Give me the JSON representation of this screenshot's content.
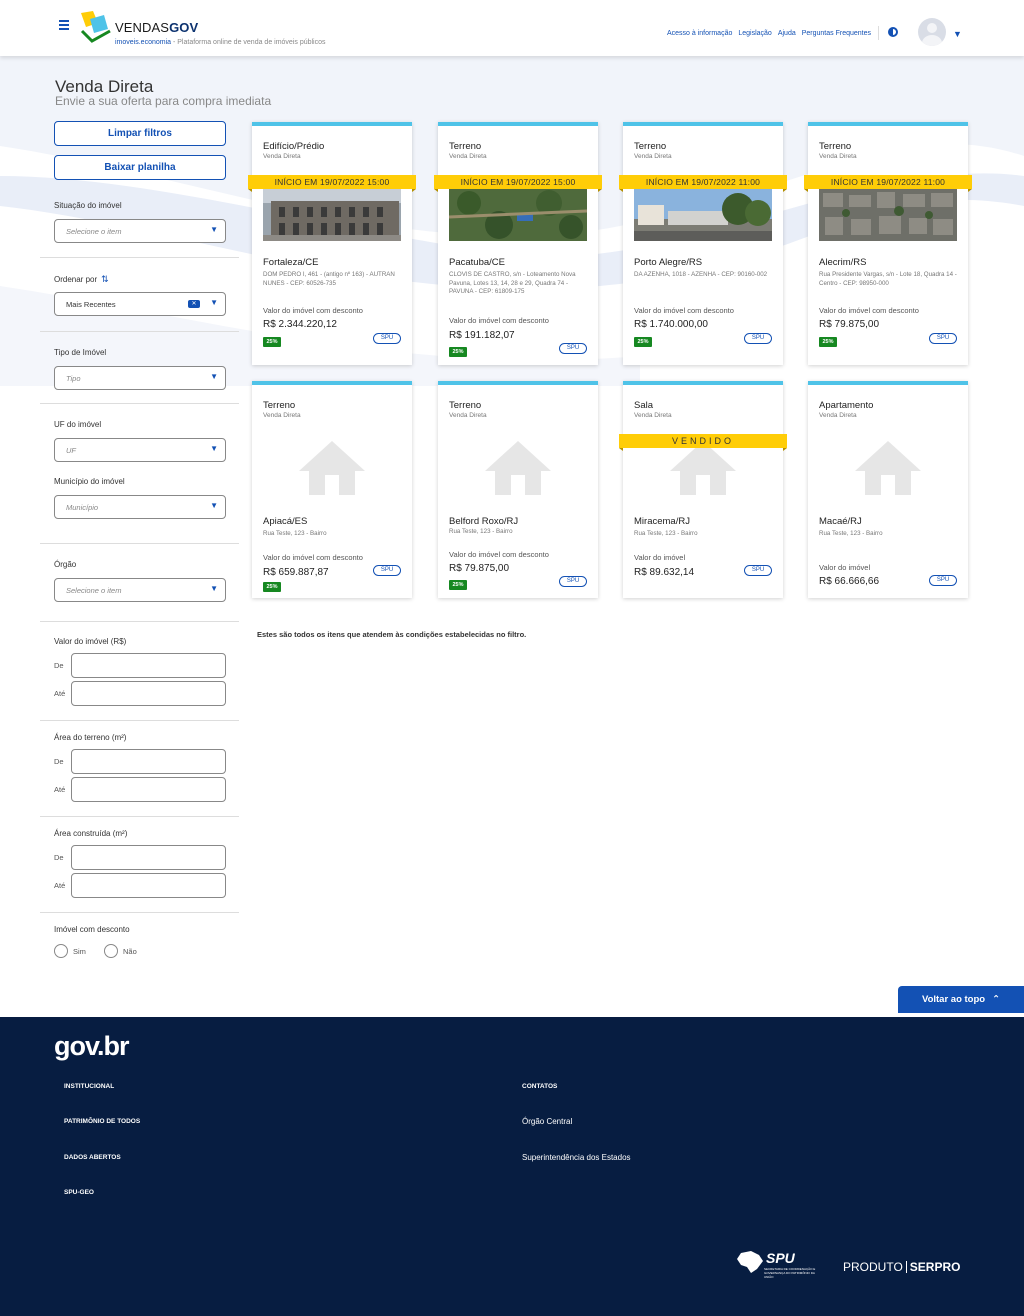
{
  "header": {
    "brand_prefix": "VENDAS",
    "brand_suffix": "GOV",
    "subtitle_domain": "imoveis.economia",
    "subtitle_text": " - Plataforma online de venda de imóveis públicos",
    "links": [
      "Acesso à informação",
      "Legislação",
      "Ajuda",
      "Perguntas Frequentes"
    ],
    "colors": {
      "primary": "#1351b4",
      "accent_yellow": "#ffcd07",
      "footer_bg": "#071d41"
    }
  },
  "page": {
    "title": "Venda Direta",
    "subtitle": "Envie a sua oferta para compra imediata"
  },
  "sidebar": {
    "clear_filters": "Limpar filtros",
    "download_sheet": "Baixar planilha",
    "situation_label": "Situação do imóvel",
    "situation_placeholder": "Selecione o item",
    "order_label": "Ordenar por",
    "order_value": "Mais Recentes",
    "type_label": "Tipo de Imóvel",
    "type_placeholder": "Tipo",
    "uf_label": "UF do imóvel",
    "uf_placeholder": "UF",
    "city_label": "Município do imóvel",
    "city_placeholder": "Município",
    "organ_label": "Órgão",
    "organ_placeholder": "Selecione o item",
    "value_label": "Valor do imóvel (R$)",
    "land_area_label": "Área do terreno (m²)",
    "built_area_label": "Área construída (m²)",
    "from_label": "De",
    "to_label": "Até",
    "discount_label": "Imóvel com desconto",
    "yes_label": "Sim",
    "no_label": "Não"
  },
  "cards": [
    {
      "type": "Edifício/Prédio",
      "mode": "Venda Direta",
      "ribbon": "INÍCIO EM 19/07/2022 15:00",
      "city": "Fortaleza/CE",
      "address": "DOM PEDRO I, 461 - (antigo nº 163) - AUTRAN NUNES - CEP: 60526-735",
      "value_label": "Valor do imóvel com desconto",
      "price": "R$ 2.344.220,12",
      "discount": "25%",
      "tag": "SPU",
      "photo": "building"
    },
    {
      "type": "Terreno",
      "mode": "Venda Direta",
      "ribbon": "INÍCIO EM 19/07/2022 15:00",
      "city": "Pacatuba/CE",
      "address": "CLOVIS DE CASTRO, s/n - Loteamento Nova Pavuna, Lotes 13, 14, 28 e 29, Quadra 74 - PAVUNA - CEP: 61809-175",
      "value_label": "Valor do imóvel com desconto",
      "price": "R$ 191.182,07",
      "discount": "25%",
      "tag": "SPU",
      "photo": "aerial-green"
    },
    {
      "type": "Terreno",
      "mode": "Venda Direta",
      "ribbon": "INÍCIO EM 19/07/2022 11:00",
      "city": "Porto Alegre/RS",
      "address": "DA AZENHA, 1018 - AZENHA - CEP: 90160-002",
      "value_label": "Valor do imóvel com desconto",
      "price": "R$ 1.740.000,00",
      "discount": "25%",
      "tag": "SPU",
      "photo": "street"
    },
    {
      "type": "Terreno",
      "mode": "Venda Direta",
      "ribbon": "INÍCIO EM 19/07/2022 11:00",
      "city": "Alecrim/RS",
      "address": "Rua Presidente Vargas, s/n - Lote 18, Quadra 14 - Centro - CEP: 98950-000",
      "value_label": "Valor do imóvel com desconto",
      "price": "R$ 79.875,00",
      "discount": "25%",
      "tag": "SPU",
      "photo": "aerial-town"
    },
    {
      "type": "Terreno",
      "mode": "Venda Direta",
      "city": "Apiacá/ES",
      "address": "Rua Teste, 123 - Bairro",
      "value_label": "Valor do imóvel com desconto",
      "price": "R$ 659.887,87",
      "discount": "25%",
      "tag": "SPU"
    },
    {
      "type": "Terreno",
      "mode": "Venda Direta",
      "city": "Belford Roxo/RJ",
      "address": "Rua Teste, 123 - Bairro",
      "value_label": "Valor do imóvel com desconto",
      "price": "R$ 79.875,00",
      "discount": "25%",
      "tag": "SPU"
    },
    {
      "type": "Sala",
      "mode": "Venda Direta",
      "ribbon": "VENDIDO",
      "city": "Miracema/RJ",
      "address": "Rua Teste, 123 - Bairro",
      "value_label": "Valor do imóvel",
      "price": "R$ 89.632,14",
      "tag": "SPU"
    },
    {
      "type": "Apartamento",
      "mode": "Venda Direta",
      "city": "Macaé/RJ",
      "address": "Rua Teste, 123 - Bairro",
      "value_label": "Valor do imóvel",
      "price": "R$ 66.666,66",
      "tag": "SPU"
    }
  ],
  "results_note": "Estes são todos os itens que atendem às condições estabelecidas no filtro.",
  "back_to_top": "Voltar ao topo",
  "footer": {
    "logo": "gov.br",
    "left_links": [
      "INSTITUCIONAL",
      "PATRIMÔNIO DE TODOS",
      "DADOS ABERTOS",
      "SPU-GEO"
    ],
    "contacts_title": "CONTATOS",
    "contacts": [
      "Órgão Central",
      "Superintendência dos Estados"
    ],
    "spu_logo": "SPU",
    "spu_small": "SECRETARIA DE COORDENAÇÃO E GOVERNANÇA DO PATRIMÔNIO DA UNIÃO",
    "serpro_prefix": "PRODUTO",
    "serpro_brand": "SERPRO"
  }
}
